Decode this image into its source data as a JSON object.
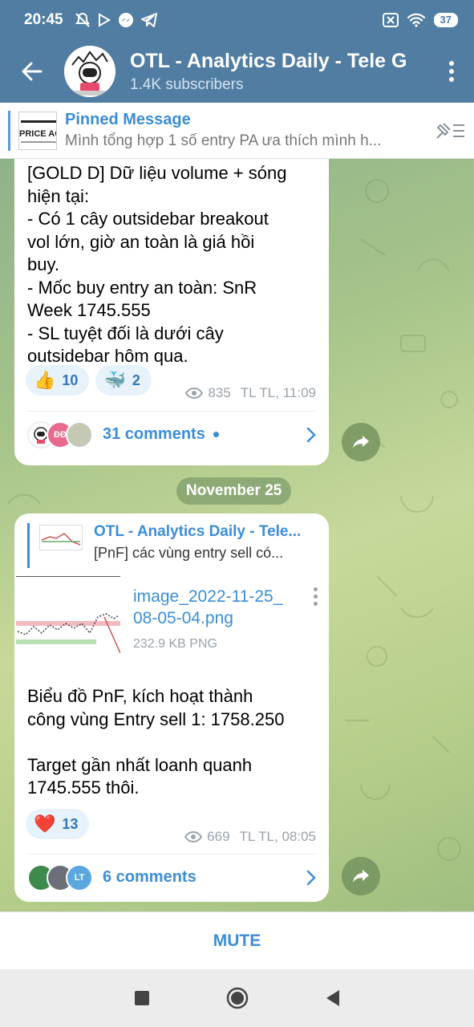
{
  "status_bar": {
    "time": "20:45",
    "battery": "37"
  },
  "header": {
    "title": "OTL - Analytics Daily - Tele G",
    "subtitle": "1.4K subscribers"
  },
  "pinned": {
    "title": "Pinned Message",
    "preview": "Mình tổng hợp 1 số entry PA ưa thích mình h...",
    "thumb_text": "PRICE ACTION"
  },
  "messages": [
    {
      "text": "[GOLD D] Dữ liệu volume + sóng\nhiện tại:\n- Có 1 cây outsidebar breakout\nvol lớn, giờ an toàn là giá hồi\nbuy.\n- Mốc buy entry an toàn: SnR\nWeek 1745.555\n- SL tuyệt đối là dưới cây\noutsidebar hôm qua.",
      "reactions": [
        {
          "emoji": "👍",
          "count": "10"
        },
        {
          "emoji": "🐳",
          "count": "2"
        }
      ],
      "views": "835",
      "author_time": "TL TL, 11:09",
      "comments": "31 comments",
      "comment_avatars": [
        {
          "text": ""
        },
        {
          "text": "ĐĐ"
        },
        {
          "text": ""
        }
      ]
    },
    {
      "date": "November 25",
      "reply_title": "OTL - Analytics Daily - Tele...",
      "reply_body": "[PnF] các vùng entry sell có...",
      "file_name": "image_2022-11-25_\n08-05-04.png",
      "file_size": "232.9 KB PNG",
      "text": "Biểu đồ PnF, kích hoạt thành\ncông vùng Entry sell 1: 1758.250\n\nTarget gần nhất loanh quanh\n1745.555 thôi.",
      "reactions": [
        {
          "emoji": "❤️",
          "count": "13"
        }
      ],
      "views": "669",
      "author_time": "TL TL, 08:05",
      "comments": "6 comments",
      "comment_avatars": [
        {
          "text": ""
        },
        {
          "text": ""
        },
        {
          "text": "LT"
        }
      ]
    }
  ],
  "mute_label": "MUTE",
  "colors": {
    "header": "#517da2",
    "accent": "#3b8ed6",
    "bubble": "#ffffff"
  }
}
